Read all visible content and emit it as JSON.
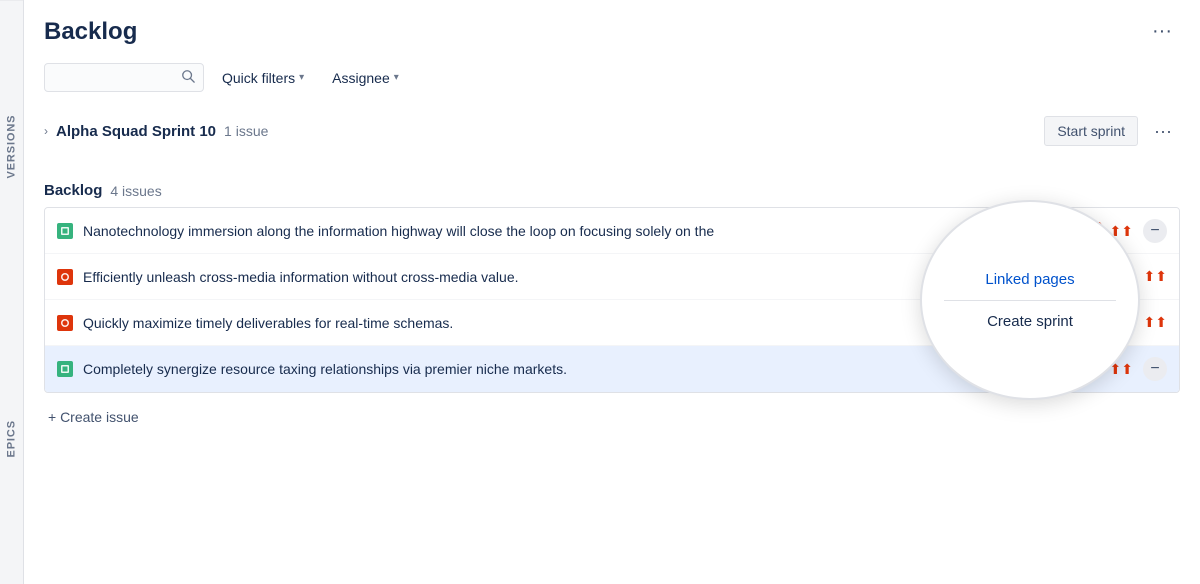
{
  "header": {
    "title": "Backlog",
    "more_label": "···"
  },
  "toolbar": {
    "search_placeholder": "",
    "quick_filters_label": "Quick filters",
    "assignee_label": "Assignee"
  },
  "side_labels": {
    "versions": "VERSIONS",
    "epics": "EPICS"
  },
  "sprint": {
    "name": "Alpha Squad Sprint 10",
    "issue_count": "1 issue",
    "start_sprint_label": "Start sprint",
    "linked_pages_label": "Linked pages",
    "create_sprint_label": "Create sprint"
  },
  "backlog": {
    "title": "Backlog",
    "issue_count": "4 issues"
  },
  "issues": [
    {
      "id": "SB-9",
      "type": "story",
      "text": "Nanotechnology immersion along the information highway will close the loop on focusing solely on the",
      "priority": "highest",
      "has_minus": true,
      "highlighted": false
    },
    {
      "id": "SB-10",
      "type": "bug",
      "text": "Efficiently unleash cross-media information without cross-media value.",
      "priority": "highest",
      "has_minus": false,
      "highlighted": false
    },
    {
      "id": "SB-11",
      "type": "bug",
      "text": "Quickly maximize timely deliverables for real-time schemas.",
      "priority": "highest",
      "has_minus": false,
      "highlighted": false
    },
    {
      "id": "SB-12",
      "type": "story",
      "text": "Completely synergize resource taxing relationships via premier niche markets.",
      "priority": "highest",
      "has_minus": true,
      "highlighted": true
    }
  ],
  "create_issue_label": "+ Create issue",
  "popup": {
    "linked_pages": "Linked pages",
    "create_sprint": "Create sprint"
  },
  "icons": {
    "search": "🔍",
    "chevron_down": "▾",
    "chevron_right": "›",
    "more": "···",
    "priority_highest": "⬆",
    "story_letter": "S",
    "bug_letter": "B"
  }
}
